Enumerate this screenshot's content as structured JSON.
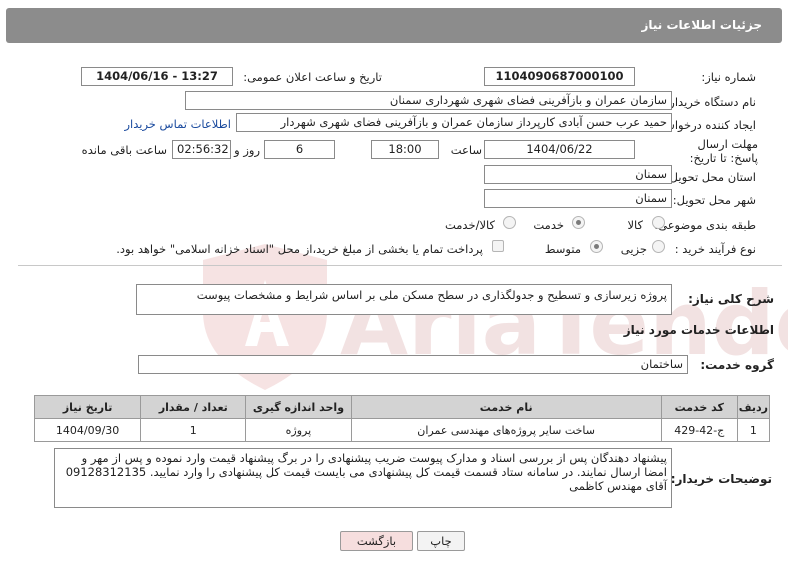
{
  "header": {
    "title": "جزئیات اطلاعات نیاز"
  },
  "need_number": {
    "label": "شماره نیاز:",
    "value": "1104090687000100"
  },
  "announce": {
    "label": "تاریخ و ساعت اعلان عمومی:",
    "value": "1404/06/16 - 13:27"
  },
  "buyer_org": {
    "label": "نام دستگاه خریدار:",
    "value": "سازمان عمران و بازآفرینی فضای شهری شهرداری سمنان"
  },
  "requester": {
    "label": "ایجاد کننده درخواست:",
    "value": "حمید عرب حسن آبادی کارپرداز سازمان عمران و بازآفرینی فضای شهری شهردار",
    "contact_link": "اطلاعات تماس خریدار"
  },
  "deadline": {
    "label": "مهلت ارسال پاسخ: تا تاریخ:",
    "date": "1404/06/22",
    "time_label": "ساعت",
    "time": "18:00",
    "days": "6",
    "days_label": "روز و",
    "remaining": "02:56:32",
    "remaining_label": "ساعت باقی مانده"
  },
  "province": {
    "label": "استان محل تحویل:",
    "value": "سمنان"
  },
  "city": {
    "label": "شهر محل تحویل:",
    "value": "سمنان"
  },
  "category": {
    "label": "طبقه بندی موضوعی:",
    "options": [
      "کالا",
      "خدمت",
      "کالا/خدمت"
    ],
    "selected": "خدمت"
  },
  "purchase": {
    "label": "نوع فرآیند خرید :",
    "options": [
      "جزیی",
      "متوسط"
    ],
    "selected": "متوسط",
    "note": "پرداخت تمام یا بخشی از مبلغ خرید،از محل \"اسناد خزانه اسلامی\" خواهد بود."
  },
  "description": {
    "label": "شرح کلی نیاز:",
    "value": "پروژه زیرسازی و تسطیح و جدولگذاری در سطح مسکن ملی بر اساس شرایط و مشخصات پیوست"
  },
  "services_title": "اطلاعات خدمات مورد نیاز",
  "service_group": {
    "label": "گروه خدمت:",
    "value": "ساختمان"
  },
  "table": {
    "headers": [
      "ردیف",
      "کد خدمت",
      "نام خدمت",
      "واحد اندازه گیری",
      "تعداد / مقدار",
      "تاریخ نیاز"
    ],
    "rows": [
      [
        "1",
        "ج-42-429",
        "ساخت سایر پروژه‌های مهندسی عمران",
        "پروژه",
        "1",
        "1404/09/30"
      ]
    ]
  },
  "buyer_notes": {
    "label": "توضیحات خریدار:",
    "value": "پیشنهاد دهندگان پس از بررسی اسناد و مدارک پیوست ضریب پیشنهادی را در برگ پیشنهاد قیمت وارد نموده و پس از مهر و امضا ارسال نمایند. در سامانه ستاد قسمت قیمت کل پیشنهادی می بایست قیمت کل پیشنهادی را وارد نمایید. 09128312135 آقای مهندس کاظمی"
  },
  "buttons": {
    "print": "چاپ",
    "back": "بازگشت"
  },
  "watermark": "AriaTender.net",
  "colors": {
    "header_bg": "#8c8c8c",
    "link": "#1a4a9e",
    "back_btn": "#f6dede"
  }
}
